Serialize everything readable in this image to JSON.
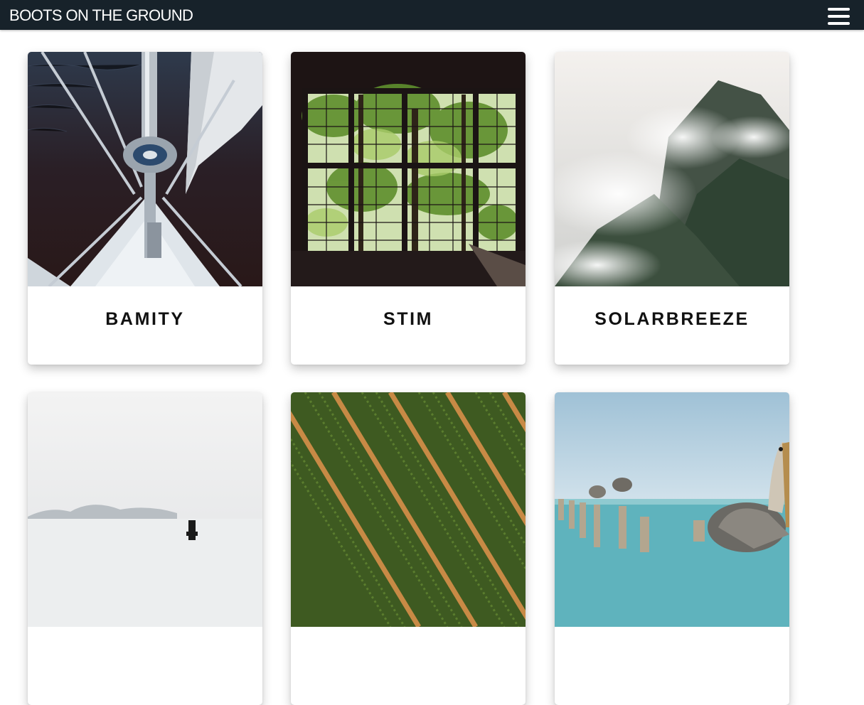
{
  "header": {
    "brand": "BOOTS ON THE GROUND",
    "menu_icon": "hamburger-menu-icon",
    "background_color": "#17222a"
  },
  "gallery": {
    "items": [
      {
        "title": "BAMITY",
        "image": "sailboat-bow-photo"
      },
      {
        "title": "STIM",
        "image": "window-with-trees-photo"
      },
      {
        "title": "SOLARBREEZE",
        "image": "misty-mountain-photo"
      },
      {
        "title": "",
        "image": "foggy-sea-photo"
      },
      {
        "title": "",
        "image": "aerial-crop-field-photo"
      },
      {
        "title": "",
        "image": "pelicans-on-pier-photo"
      }
    ]
  }
}
